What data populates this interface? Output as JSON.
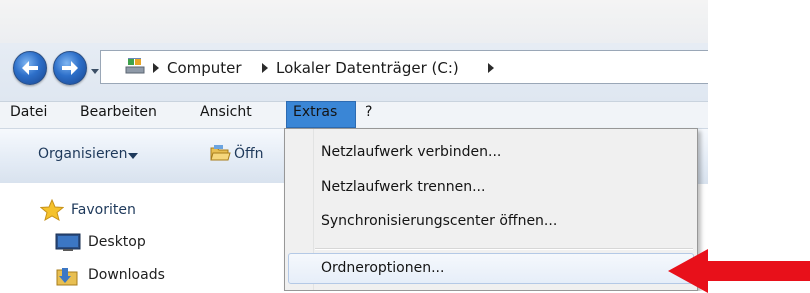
{
  "address_bar": {
    "breadcrumbs": [
      "Computer",
      "Lokaler Datenträger (C:)"
    ]
  },
  "menubar": {
    "items": [
      "Datei",
      "Bearbeiten",
      "Ansicht",
      "Extras",
      "?"
    ],
    "active_item": "Extras"
  },
  "toolbar": {
    "organize_label": "Organisieren",
    "open_label": "Öffn"
  },
  "navigation_pane": {
    "favorites_label": "Favoriten",
    "items": [
      "Desktop",
      "Downloads"
    ]
  },
  "extras_menu": {
    "items": [
      "Netzlaufwerk verbinden...",
      "Netzlaufwerk trennen...",
      "Synchronisierungscenter öffnen...",
      "Ordneroptionen..."
    ],
    "highlighted_item": "Ordneroptionen..."
  },
  "colors": {
    "menu_highlight": "#3a86d6",
    "annotation_arrow": "#e8101a"
  },
  "icons": [
    "back-icon",
    "forward-icon",
    "drive-icon",
    "open-folder-icon",
    "star-icon",
    "desktop-icon",
    "downloads-icon"
  ]
}
